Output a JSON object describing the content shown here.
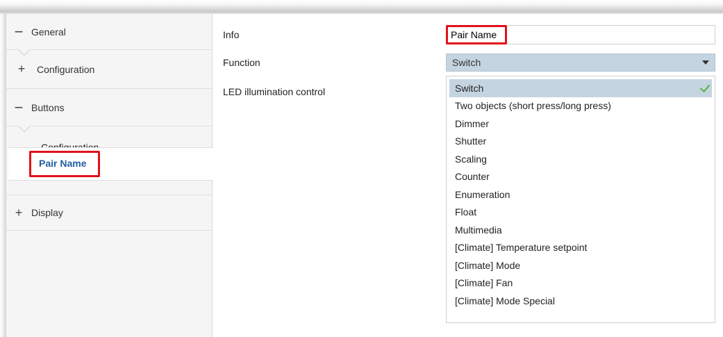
{
  "sidebar": {
    "general": {
      "toggle": "−",
      "label": "General"
    },
    "general_configuration": {
      "toggle": "+",
      "label": "Configuration"
    },
    "buttons": {
      "toggle": "−",
      "label": "Buttons"
    },
    "buttons_configuration": {
      "label": "Configuration"
    },
    "pair_name": {
      "label": "Pair Name"
    },
    "display": {
      "toggle": "+",
      "label": "Display"
    }
  },
  "main": {
    "info_label": "Info",
    "info_value": "Pair Name",
    "function_label": "Function",
    "function_value": "Switch",
    "led_label": "LED illumination control",
    "function_options": [
      "Switch",
      "Two objects (short press/long press)",
      "Dimmer",
      "Shutter",
      "Scaling",
      "Counter",
      "Enumeration",
      "Float",
      "Multimedia",
      "[Climate] Temperature setpoint",
      "[Climate] Mode",
      "[Climate] Fan",
      "[Climate] Mode Special"
    ],
    "selected_option_index": 0
  },
  "colors": {
    "highlight_red": "#e2101a",
    "selection_blue": "#c5d4e1",
    "selected_label_blue": "#1f5f9e",
    "check_green": "#5cae3c"
  },
  "icons": {
    "collapse": "minus-icon",
    "expand": "plus-icon",
    "dropdown": "chevron-down-icon",
    "selected": "checkmark-icon"
  }
}
